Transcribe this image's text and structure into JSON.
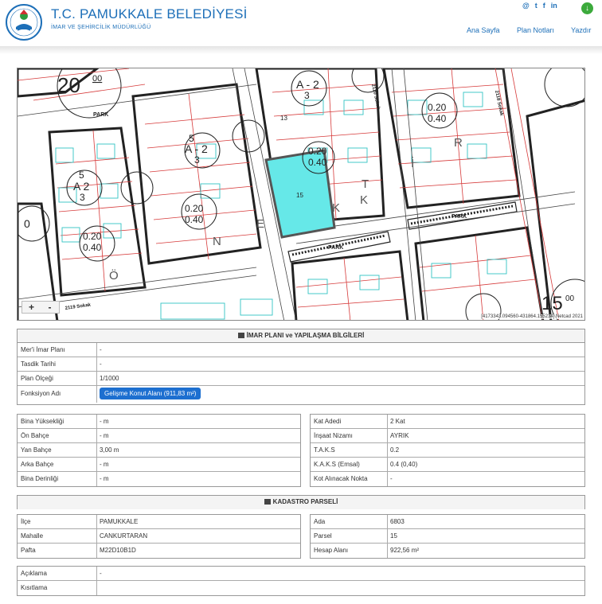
{
  "header": {
    "title": "T.C. PAMUKKALE BELEDİYESİ",
    "subtitle": "İMAR VE ŞEHİRCİLİK MÜDÜRLÜĞÜ",
    "social": [
      "@",
      "t",
      "f",
      "in"
    ],
    "download_icon": "download-icon",
    "nav": {
      "home": "Ana Sayfa",
      "notes": "Plan Notları",
      "print": "Yazdır"
    },
    "accent": "#1d6fb8"
  },
  "map": {
    "zoom_in": "+",
    "zoom_out": "-",
    "coords": "[4173343.094560-431864.155234] Netcad 2021",
    "labels": {
      "n20": "20",
      "n00a": "00",
      "n15": "15",
      "n00b": "00",
      "n0": "0",
      "a2a": "A - 2",
      "a2a_n": "3",
      "a2b": "A - 2",
      "a2b_n": "3",
      "a2c": "A 2",
      "a2c_n": "3",
      "a2c_t": "5",
      "a2b_t": "5",
      "r1a": "0.20",
      "r1b": "0.40",
      "r2a": "0.20",
      "r2b": "0.40",
      "r3a": "0.20",
      "r3b": "0.40",
      "r4a": "0.20",
      "r4b": "0.40",
      "p15": "15",
      "p13": "13",
      "park1": "PARK",
      "park2": "PARK",
      "park3": "PARK",
      "s1": "2119 Sokak",
      "s2": "2118 Sokak",
      "s3": "2120 Sokak",
      "k": "K",
      "e": "E",
      "n": "N",
      "t": "T",
      "r": "R",
      "i": "İ",
      "o": "Ö",
      "k2": "K"
    },
    "highlight_color": "#66e8e8"
  },
  "imar": {
    "heading": "İMAR PLANI ve YAPILAŞMA BİLGİLERİ",
    "rows": [
      {
        "label": "Mer'i İmar Planı",
        "value": "-"
      },
      {
        "label": "Tasdik Tarihi",
        "value": "-"
      },
      {
        "label": "Plan Ölçeği",
        "value": "1/1000"
      }
    ],
    "function_label": "Fonksiyon Adı",
    "function_value": "Gelişme Konut Alanı (911,83 m²)"
  },
  "build_left": [
    {
      "label": "Bina Yüksekliği",
      "value": "- m"
    },
    {
      "label": "Ön Bahçe",
      "value": "- m"
    },
    {
      "label": "Yan Bahçe",
      "value": "3,00 m"
    },
    {
      "label": "Arka Bahçe",
      "value": "- m"
    },
    {
      "label": "Bina Derinliği",
      "value": "- m"
    }
  ],
  "build_right": [
    {
      "label": "Kat Adedi",
      "value": "2 Kat"
    },
    {
      "label": "İnşaat Nizamı",
      "value": "AYRIK"
    },
    {
      "label": "T.A.K.S",
      "value": "0.2"
    },
    {
      "label": "K.A.K.S (Emsal)",
      "value": "0.4 (0,40)"
    },
    {
      "label": "Kot Alınacak Nokta",
      "value": "-"
    }
  ],
  "kadastro": {
    "heading": "KADASTRO PARSELİ",
    "left": [
      {
        "label": "İlçe",
        "value": "PAMUKKALE"
      },
      {
        "label": "Mahalle",
        "value": "CANKURTARAN"
      },
      {
        "label": "Pafta",
        "value": "M22D10B1D"
      }
    ],
    "right": [
      {
        "label": "Ada",
        "value": "6803"
      },
      {
        "label": "Parsel",
        "value": "15"
      },
      {
        "label": "Hesap Alanı",
        "value": "922,56 m²"
      }
    ]
  },
  "notes": [
    {
      "label": "Açıklama",
      "value": "-"
    },
    {
      "label": "Kısıtlama",
      "value": ""
    }
  ]
}
